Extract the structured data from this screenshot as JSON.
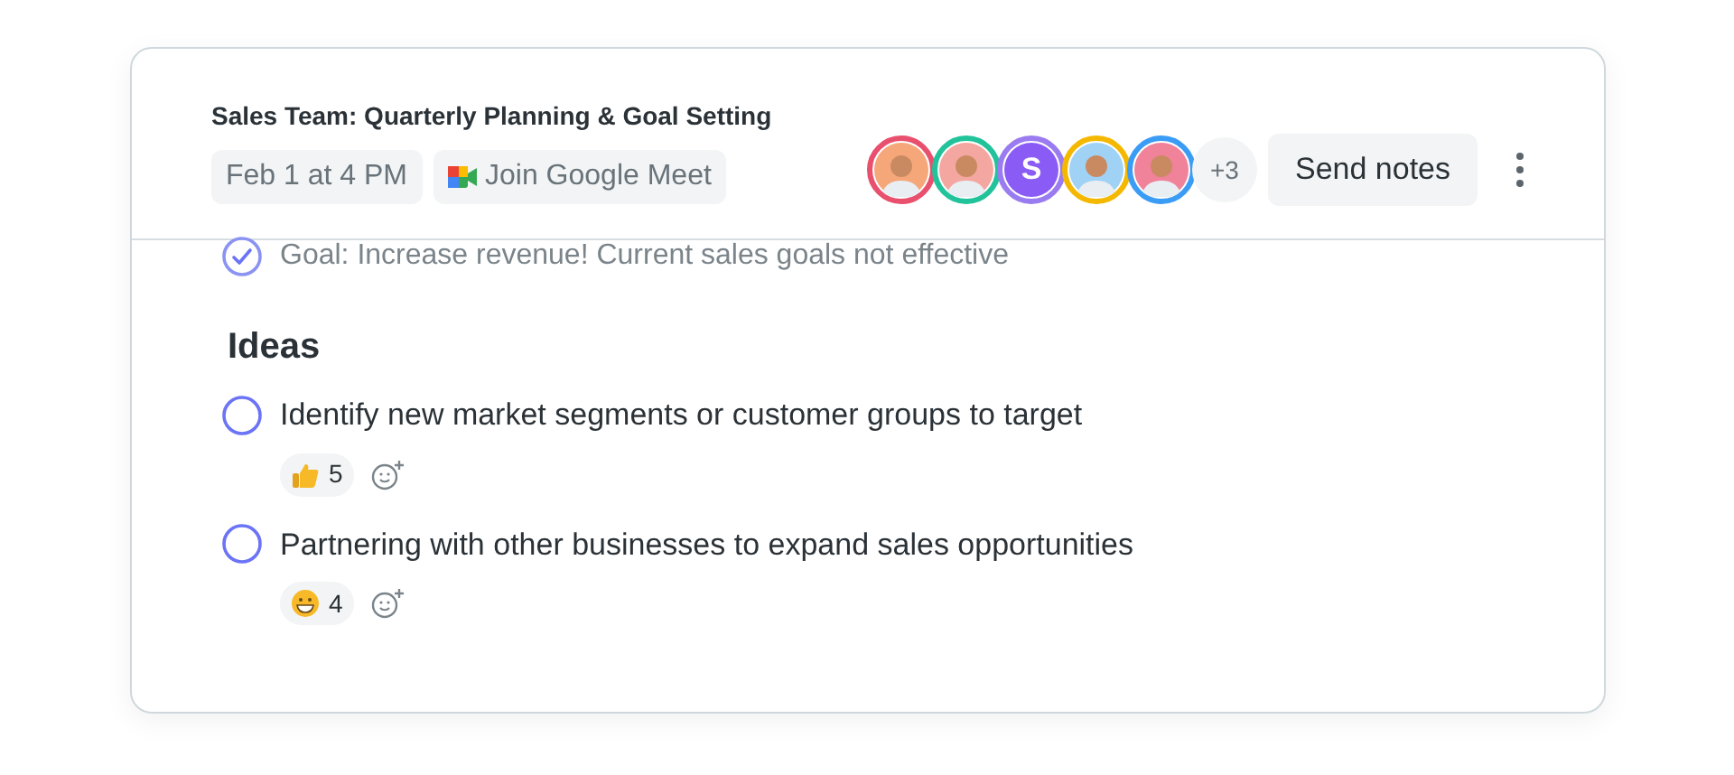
{
  "meeting": {
    "title": "Sales Team: Quarterly Planning & Goal Setting",
    "date": "Feb 1 at 4 PM",
    "join_link": "Join Google Meet"
  },
  "attendees": [
    {
      "kind": "photo",
      "color": "#e8506e"
    },
    {
      "kind": "photo",
      "color": "#22c39a"
    },
    {
      "kind": "letter",
      "letter": "S",
      "color": "#9b7cf0"
    },
    {
      "kind": "photo",
      "color": "#f5b800"
    },
    {
      "kind": "photo",
      "color": "#3b9cf5"
    }
  ],
  "more_attendees": "+3",
  "send_button": "Send notes",
  "goal": {
    "text": "Goal: Increase revenue! Current sales goals not effective",
    "checked": true
  },
  "section_heading": "Ideas",
  "ideas": [
    {
      "text": "Identify new market segments or customer groups to target",
      "checked": false,
      "reaction": {
        "kind": "thumbs_up",
        "count": "5"
      }
    },
    {
      "text": "Partnering with other businesses to expand sales opportunities",
      "checked": false,
      "reaction": {
        "kind": "grin",
        "count": "4"
      }
    }
  ]
}
